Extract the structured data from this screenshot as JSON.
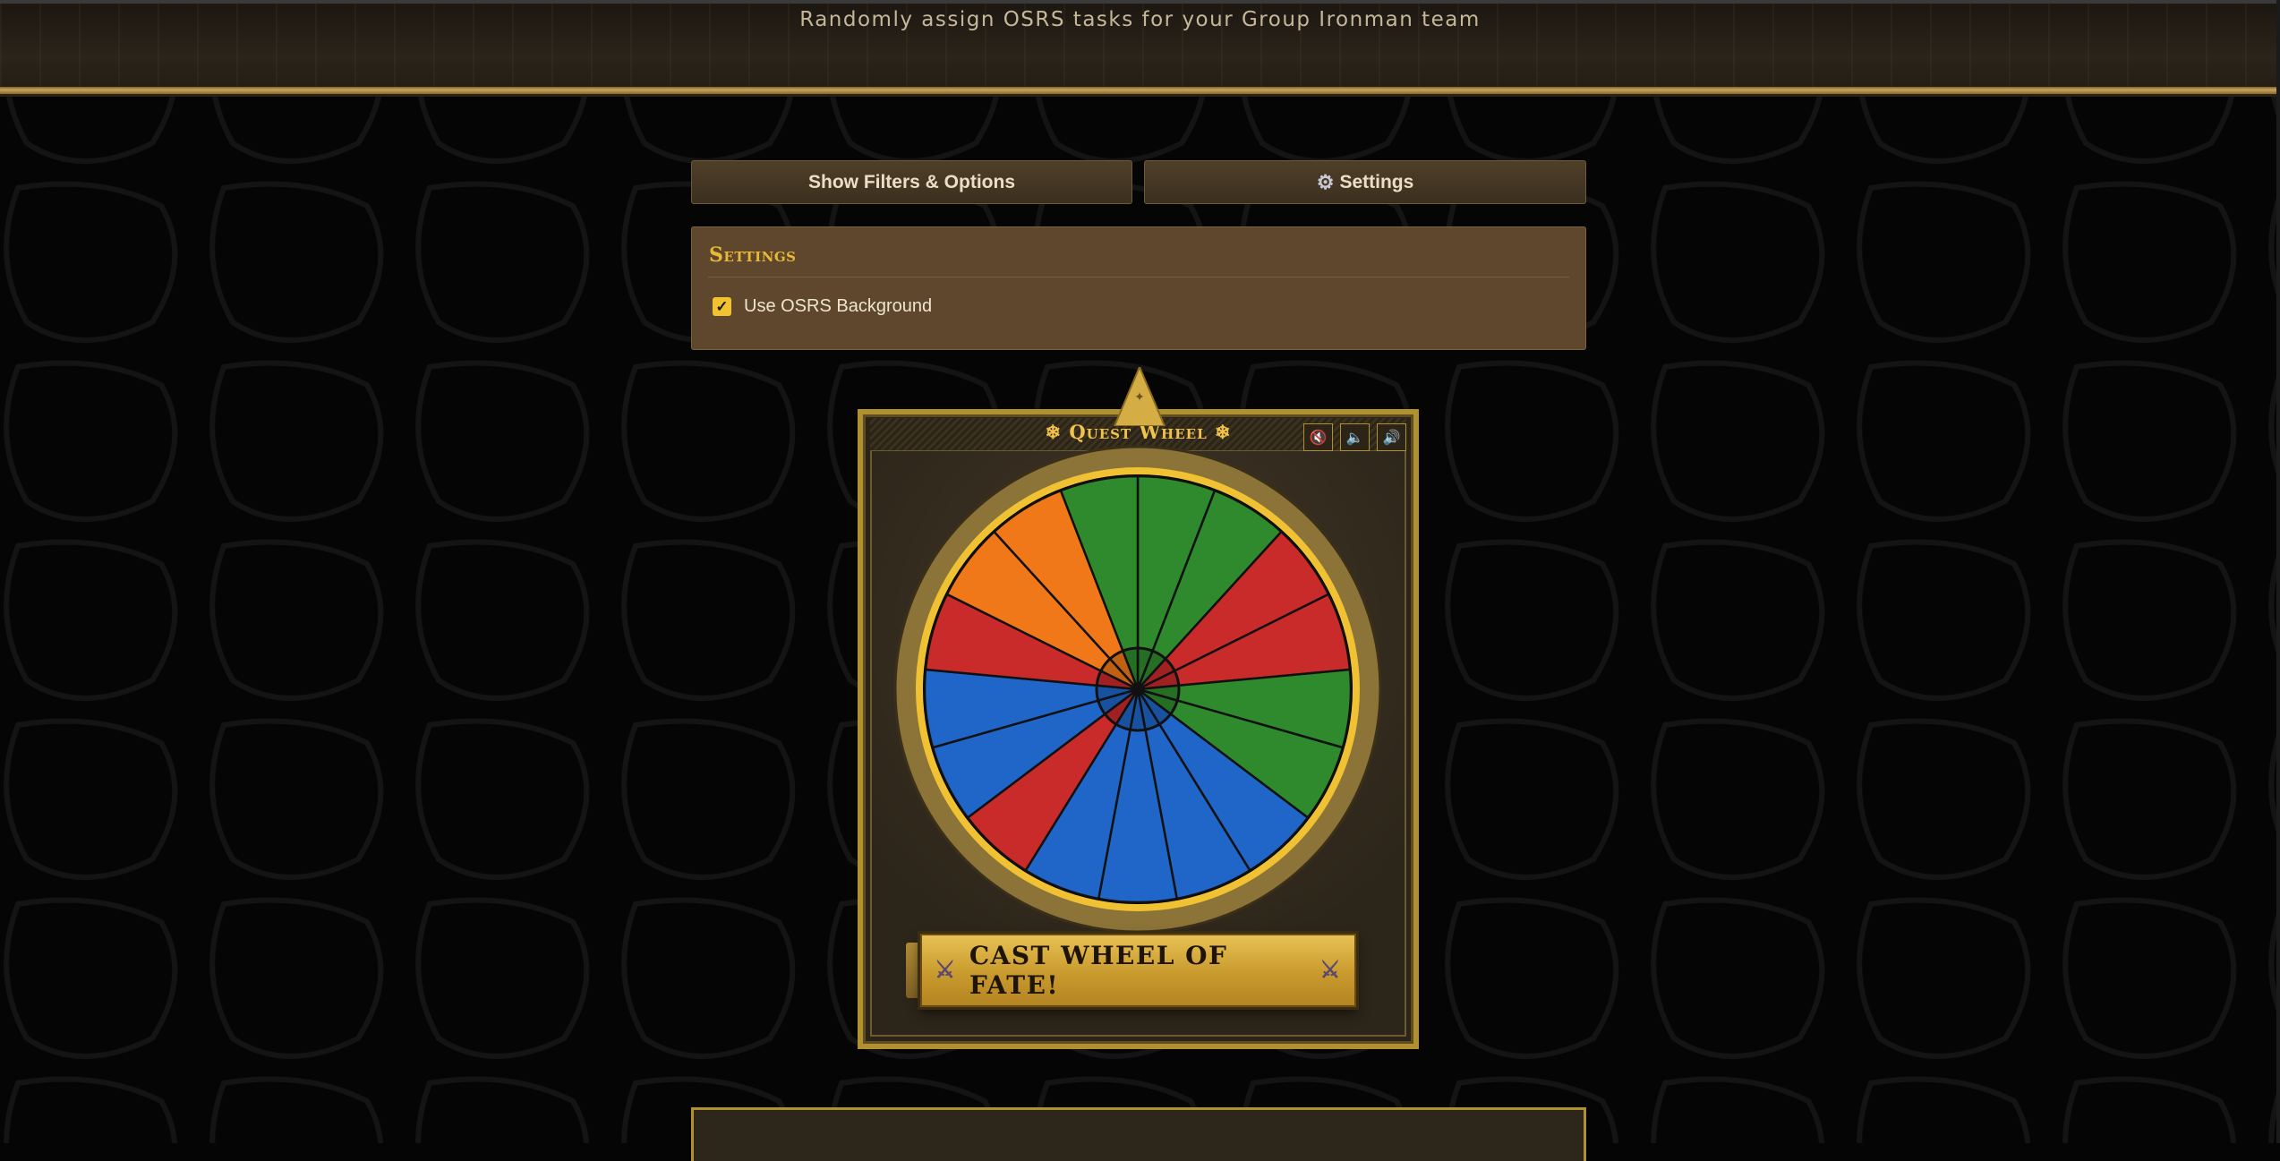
{
  "header": {
    "subtitle": "Randomly assign OSRS tasks for your Group Ironman team"
  },
  "toolbar": {
    "filters_label": "Show Filters & Options",
    "settings_label": "Settings",
    "settings_icon": "gear-icon"
  },
  "settings_panel": {
    "title": "Settings",
    "options": [
      {
        "label": "Use OSRS Background",
        "checked": true
      }
    ]
  },
  "wheel": {
    "title": "❄ Quest Wheel ❄",
    "sound_buttons": [
      "mute-icon",
      "volume-low-icon",
      "volume-high-icon"
    ],
    "segment_colors": [
      "#2f8a2e",
      "#2f8a2e",
      "#c92a2a",
      "#c92a2a",
      "#2f8a2e",
      "#2f8a2e",
      "#1f66c8",
      "#1f66c8",
      "#1f66c8",
      "#1f66c8",
      "#c92a2a",
      "#1f66c8",
      "#1f66c8",
      "#c92a2a",
      "#f07818",
      "#f07818",
      "#2f8a2e"
    ],
    "cast_label": "CAST WHEEL OF FATE!",
    "cast_icon": "crossed-swords-icon"
  },
  "colors": {
    "gold": "#e8b935",
    "panel": "#5e472d",
    "green": "#2f8a2e",
    "red": "#c92a2a",
    "blue": "#1f66c8",
    "orange": "#f07818"
  }
}
